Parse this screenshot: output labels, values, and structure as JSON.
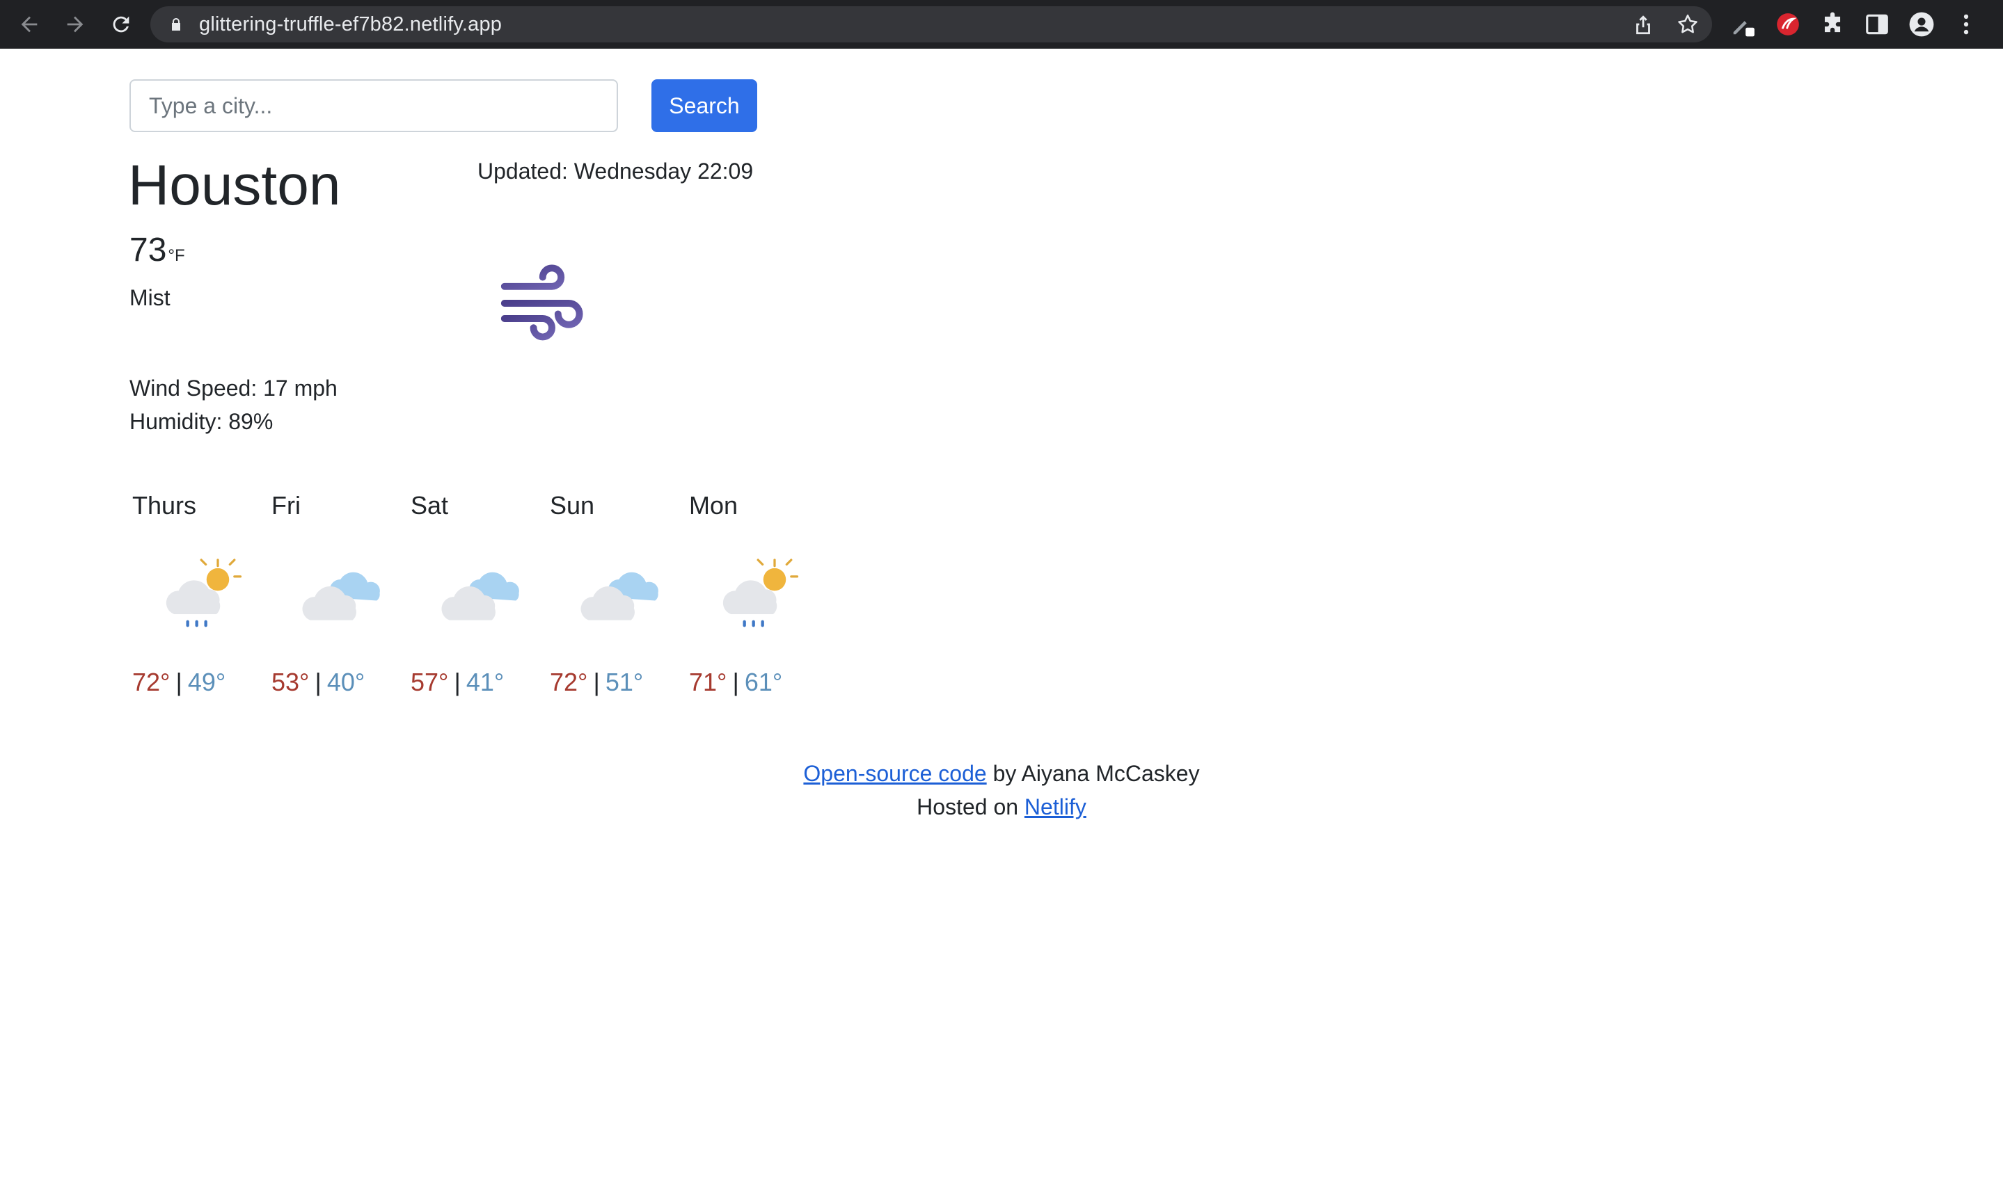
{
  "browser": {
    "url": "glittering-truffle-ef7b82.netlify.app"
  },
  "search": {
    "placeholder": "Type a city...",
    "button_label": "Search"
  },
  "current": {
    "city": "Houston",
    "updated": "Updated: Wednesday 22:09",
    "temperature": "73",
    "unit": "°F",
    "description": "Mist",
    "wind": "Wind Speed: 17 mph",
    "humidity": "Humidity: 89%",
    "icon": "wind-icon"
  },
  "forecast": [
    {
      "day": "Thurs",
      "high": "72°",
      "low": "49°",
      "separator": "|",
      "icon": "partly-sunny-rain-icon"
    },
    {
      "day": "Fri",
      "high": "53°",
      "low": "40°",
      "separator": "|",
      "icon": "cloudy-icon"
    },
    {
      "day": "Sat",
      "high": "57°",
      "low": "41°",
      "separator": "|",
      "icon": "cloudy-icon"
    },
    {
      "day": "Sun",
      "high": "72°",
      "low": "51°",
      "separator": "|",
      "icon": "cloudy-icon"
    },
    {
      "day": "Mon",
      "high": "71°",
      "low": "61°",
      "separator": "|",
      "icon": "partly-sunny-rain-icon"
    }
  ],
  "footer": {
    "code_link": "Open-source code",
    "by_text": " by Aiyana McCaskey",
    "hosted_text": "Hosted on ",
    "netlify_link": "Netlify"
  },
  "colors": {
    "accent": "#2f6fe8",
    "high_temp": "#a63a2f",
    "low_temp": "#5b8fb9",
    "link": "#1c5fd6",
    "chrome": "#202124"
  }
}
